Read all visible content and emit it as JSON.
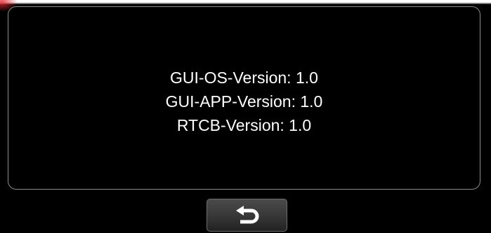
{
  "versions": [
    {
      "label": "GUI-OS-Version: 1.0"
    },
    {
      "label": "GUI-APP-Version: 1.0"
    },
    {
      "label": "RTCB-Version: 1.0"
    }
  ],
  "back_button": {
    "icon": "return-arrow-icon"
  },
  "colors": {
    "background": "#000000",
    "text": "#ffffff",
    "panel_border": "#8c8c8c",
    "button_gradient_top": "#4a4a4a",
    "button_gradient_bottom": "#222222"
  }
}
